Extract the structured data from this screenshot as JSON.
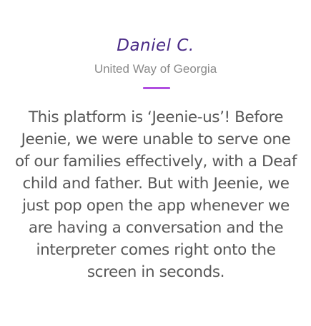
{
  "testimonial": {
    "author_name": "Daniel C.",
    "organization": "United Way of Georgia",
    "quote": "This platform is ‘Jeenie-us’! Before Jeenie, we were unable to serve one of our families effectively, with a Deaf child and father. But with Jeenie, we just pop open the app whenever we are having a conversation and the interpreter comes right onto the screen in seconds."
  },
  "colors": {
    "author_name": "#4a2a86",
    "organization": "#8a8a8a",
    "divider": "#b04ee0",
    "quote": "#575757"
  }
}
